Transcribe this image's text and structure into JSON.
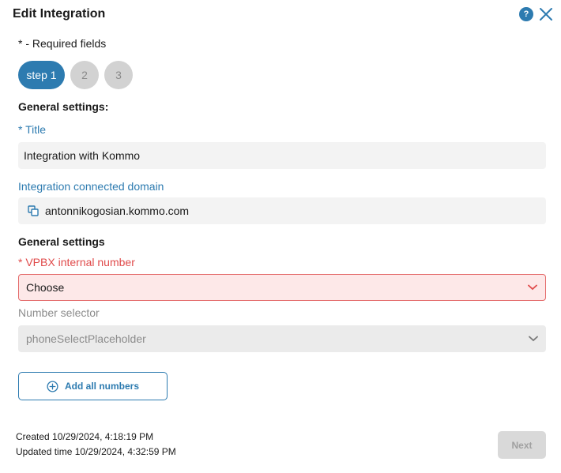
{
  "header": {
    "title": "Edit Integration",
    "help_icon": "question-mark",
    "help_glyph": "?",
    "close_icon": "close-x"
  },
  "required_note": "* - Required fields",
  "steps": [
    {
      "label": "step 1",
      "active": true
    },
    {
      "label": "2",
      "active": false
    },
    {
      "label": "3",
      "active": false
    }
  ],
  "general_settings_1": {
    "heading": "General settings:",
    "title_label": "* Title",
    "title_value": "Integration with Kommo",
    "domain_label": "Integration connected domain",
    "domain_icon": "copy-icon",
    "domain_value": "antonnikogosian.kommo.com"
  },
  "general_settings_2": {
    "heading": "General settings",
    "vpbx_label": "* VPBX internal number",
    "vpbx_value": "Choose",
    "number_label": "Number selector",
    "number_placeholder": "phoneSelectPlaceholder"
  },
  "add_all_numbers": {
    "label": "Add all numbers",
    "icon": "plus-circle"
  },
  "footer": {
    "created": "Created 10/29/2024, 4:18:19 PM",
    "updated": "Updated time 10/29/2024, 4:32:59 PM",
    "next_label": "Next",
    "next_enabled": false
  },
  "colors": {
    "accent": "#2d7bb0",
    "error": "#e04b4b",
    "error_bg": "#fde8e8",
    "disabled": "#d9d9d9"
  }
}
